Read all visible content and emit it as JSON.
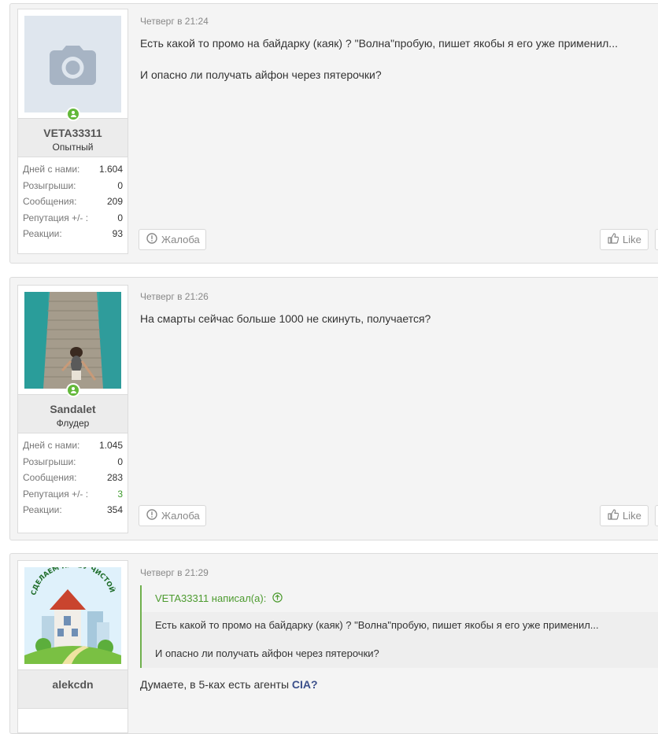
{
  "posts": [
    {
      "user": {
        "name": "VETA33311",
        "title": "Опытный",
        "stats": [
          {
            "label": "Дней с нами:",
            "value": "1.604"
          },
          {
            "label": "Розыгрыши:",
            "value": "0"
          },
          {
            "label": "Сообщения:",
            "value": "209"
          },
          {
            "label": "Репутация +/- :",
            "value": "0"
          },
          {
            "label": "Реакции:",
            "value": "93"
          }
        ]
      },
      "date": "Четверг в 21:24",
      "text": [
        "Есть какой то промо на байдарку (каяк) ? \"Волна\"пробую, пишет якобы я его уже применил...",
        "И опасно ли получать айфон через пятерочки?"
      ],
      "report_label": "Жалоба",
      "like_label": "Like"
    },
    {
      "user": {
        "name": "Sandalet",
        "title": "Флудер",
        "stats": [
          {
            "label": "Дней с нами:",
            "value": "1.045"
          },
          {
            "label": "Розыгрыши:",
            "value": "0"
          },
          {
            "label": "Сообщения:",
            "value": "283"
          },
          {
            "label": "Репутация +/- :",
            "value": "3"
          },
          {
            "label": "Реакции:",
            "value": "354"
          }
        ]
      },
      "date": "Четверг в 21:26",
      "text": [
        "На смарты сейчас больше 1000 не скинуть, получается?"
      ],
      "report_label": "Жалоба",
      "like_label": "Like"
    },
    {
      "user": {
        "name": "alekcdn",
        "avatar_text": "СДЕЛАЕМ НАРВУ ЧИСТОЙ"
      },
      "date": "Четверг в 21:29",
      "quote": {
        "author": "VETA33311 написал(а):",
        "lines": [
          "Есть какой то промо на байдарку (каяк) ? \"Волна\"пробую, пишет якобы я его уже применил...",
          "И опасно ли получать айфон через пятерочки?"
        ]
      },
      "text_prefix": "Думаете, в 5-ках есть агенты ",
      "text_bold": "CIA?"
    }
  ],
  "colors": {
    "post_bg": "#f4f4f4",
    "online": "#63b83a",
    "positive": "#3f9b2e",
    "quote_accent": "#6fb04d"
  },
  "icons": [
    "camera-icon",
    "online-user-icon",
    "report-icon",
    "thumbs-up-icon",
    "arrow-up-icon"
  ]
}
